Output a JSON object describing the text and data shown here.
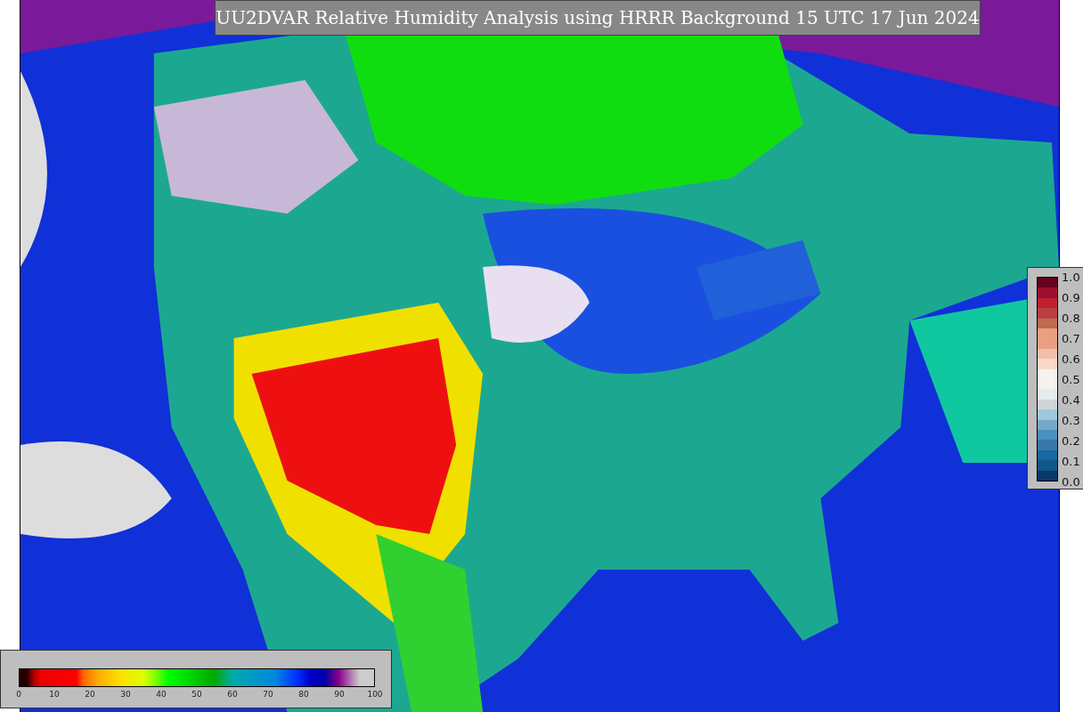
{
  "title": "UU2DVAR Relative Humidity Analysis using HRRR Background 15 UTC 17 Jun 2024",
  "humidity_colorbar": {
    "ticks": [
      "0",
      "10",
      "20",
      "30",
      "40",
      "50",
      "60",
      "70",
      "80",
      "90",
      "100"
    ]
  },
  "station_colorbar": {
    "ticks": [
      "1.0",
      "0.9",
      "0.8",
      "0.7",
      "0.6",
      "0.5",
      "0.4",
      "0.3",
      "0.2",
      "0.1",
      "0.0"
    ]
  }
}
